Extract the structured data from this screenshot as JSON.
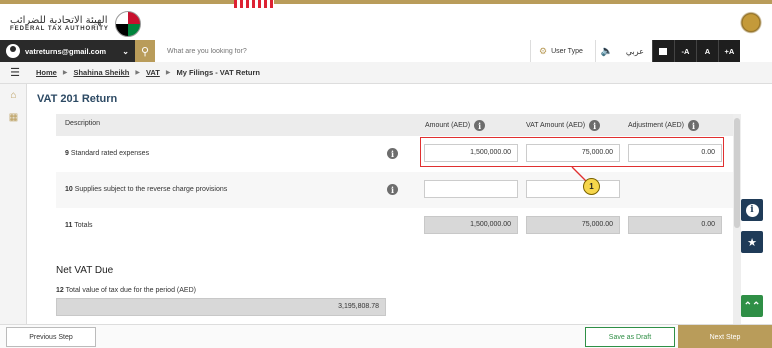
{
  "brand": {
    "logo_ar": "الهيئة الاتحادية للضرائب",
    "logo_en": "FEDERAL TAX AUTHORITY"
  },
  "navbar": {
    "account_email": "vatreturns@gmail.com",
    "search_placeholder": "What are you looking for?",
    "user_type": "User Type",
    "language": "عربي",
    "font_decrease": "-A",
    "font_normal": "A",
    "font_increase": "+A"
  },
  "breadcrumb": {
    "items": [
      "Home",
      "Shahina Sheikh",
      "VAT",
      "My Filings - VAT Return"
    ]
  },
  "page": {
    "title": "VAT 201 Return"
  },
  "table": {
    "headers": {
      "description": "Description",
      "amount": "Amount (AED)",
      "vat_amount": "VAT Amount (AED)",
      "adjustment": "Adjustment (AED)"
    },
    "rows": [
      {
        "num": "9",
        "label": "Standard rated expenses",
        "amount": "1,500,000.00",
        "vat": "75,000.00",
        "adjustment": "0.00"
      },
      {
        "num": "10",
        "label": "Supplies subject to the reverse charge provisions",
        "amount": "",
        "vat": "",
        "adjustment": ""
      },
      {
        "num": "11",
        "label": "Totals",
        "amount": "1,500,000.00",
        "vat": "75,000.00",
        "adjustment": "0.00"
      }
    ]
  },
  "callout": {
    "label": "1"
  },
  "net_vat": {
    "title": "Net VAT Due",
    "num": "12",
    "label": "Total value of tax due for the period (AED)",
    "value": "3,195,808.78"
  },
  "footer": {
    "previous": "Previous Step",
    "save_draft": "Save as Draft",
    "next": "Next Step"
  },
  "colors": {
    "gold": "#b99c5a",
    "navy": "#1f3b58",
    "green": "#2f8f46",
    "highlight": "#e03030",
    "callout": "#f6d64b"
  }
}
